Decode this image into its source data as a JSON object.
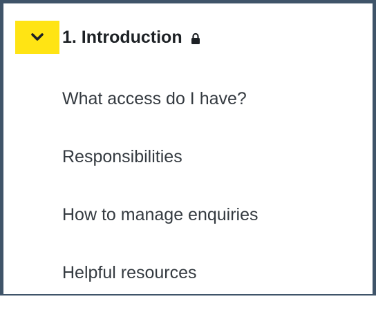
{
  "section": {
    "title": "1. Introduction",
    "toggle_icon": "chevron-down-icon",
    "lock_icon": "lock-icon",
    "highlight_color": "#ffe414",
    "border_color": "#3f5469"
  },
  "activities": [
    {
      "label": "What access do I have?"
    },
    {
      "label": "Responsibilities"
    },
    {
      "label": "How to manage enquiries"
    },
    {
      "label": "Helpful resources"
    }
  ]
}
